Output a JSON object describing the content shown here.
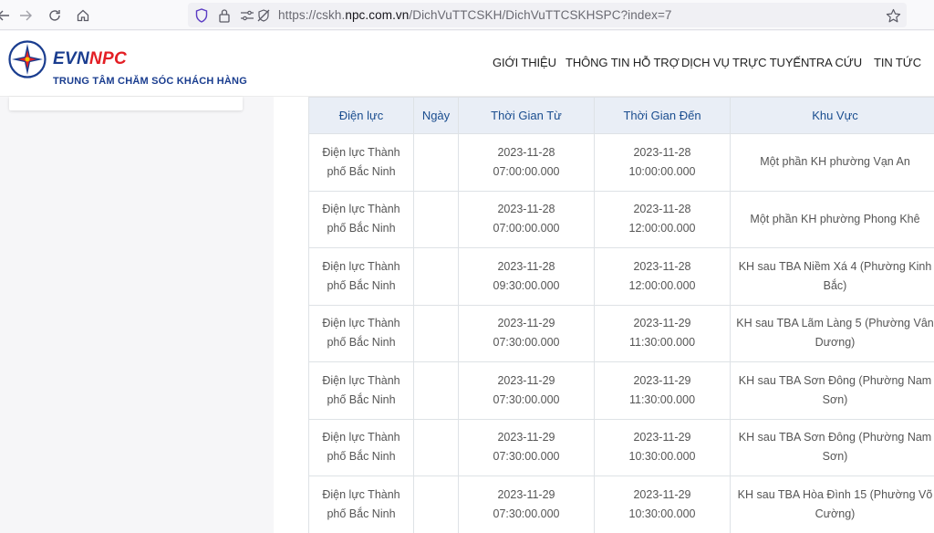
{
  "browser": {
    "url_prefix": "https://cskh.",
    "url_domain": "npc.com.vn",
    "url_path": "/DichVuTTCSKH/DichVuTTCSKHSPC?index=7"
  },
  "header": {
    "logo_evn": "EVN",
    "logo_npc": "NPC",
    "logo_subtitle": "TRUNG TÂM CHĂM SÓC KHÁCH HÀNG",
    "nav": [
      "GIỚI THIỆU",
      "THÔNG TIN HỖ TRỢ",
      "DỊCH VỤ TRỰC TUYẾN",
      "TRA CỨU",
      "TIN TỨC"
    ]
  },
  "colors": {
    "brand_blue": "#1a3d8f",
    "brand_red": "#e31e24",
    "table_header_bg": "#e9eef6",
    "table_header_text": "#1a4d8f"
  },
  "table": {
    "headers": [
      "Điện lực",
      "Ngày",
      "Thời Gian Từ",
      "Thời Gian Đến",
      "Khu Vực"
    ],
    "rows": [
      {
        "dl1": "Điện lực Thành",
        "dl2": "phố Bắc Ninh",
        "day": "",
        "from_d": "2023-11-28",
        "from_t": "07:00:00.000",
        "to_d": "2023-11-28",
        "to_t": "10:00:00.000",
        "kv1": "Một phần KH phường Vạn An",
        "kv2": ""
      },
      {
        "dl1": "Điện lực Thành",
        "dl2": "phố Bắc Ninh",
        "day": "",
        "from_d": "2023-11-28",
        "from_t": "07:00:00.000",
        "to_d": "2023-11-28",
        "to_t": "12:00:00.000",
        "kv1": "Một phần KH phường Phong Khê",
        "kv2": ""
      },
      {
        "dl1": "Điện lực Thành",
        "dl2": "phố Bắc Ninh",
        "day": "",
        "from_d": "2023-11-28",
        "from_t": "09:30:00.000",
        "to_d": "2023-11-28",
        "to_t": "12:00:00.000",
        "kv1": "KH sau TBA Niềm Xá 4 (Phường Kinh",
        "kv2": "Bắc)"
      },
      {
        "dl1": "Điện lực Thành",
        "dl2": "phố Bắc Ninh",
        "day": "",
        "from_d": "2023-11-29",
        "from_t": "07:30:00.000",
        "to_d": "2023-11-29",
        "to_t": "11:30:00.000",
        "kv1": "KH sau TBA Lãm Làng 5 (Phường Vân",
        "kv2": "Dương)"
      },
      {
        "dl1": "Điện lực Thành",
        "dl2": "phố Bắc Ninh",
        "day": "",
        "from_d": "2023-11-29",
        "from_t": "07:30:00.000",
        "to_d": "2023-11-29",
        "to_t": "11:30:00.000",
        "kv1": "KH sau TBA Sơn Đông (Phường Nam",
        "kv2": "Sơn)"
      },
      {
        "dl1": "Điện lực Thành",
        "dl2": "phố Bắc Ninh",
        "day": "",
        "from_d": "2023-11-29",
        "from_t": "07:30:00.000",
        "to_d": "2023-11-29",
        "to_t": "10:30:00.000",
        "kv1": "KH sau TBA Sơn Đông (Phường Nam",
        "kv2": "Sơn)"
      },
      {
        "dl1": "Điện lực Thành",
        "dl2": "phố Bắc Ninh",
        "day": "",
        "from_d": "2023-11-29",
        "from_t": "07:30:00.000",
        "to_d": "2023-11-29",
        "to_t": "10:30:00.000",
        "kv1": "KH sau TBA Hòa Đình 15 (Phường Võ",
        "kv2": "Cường)"
      }
    ]
  }
}
